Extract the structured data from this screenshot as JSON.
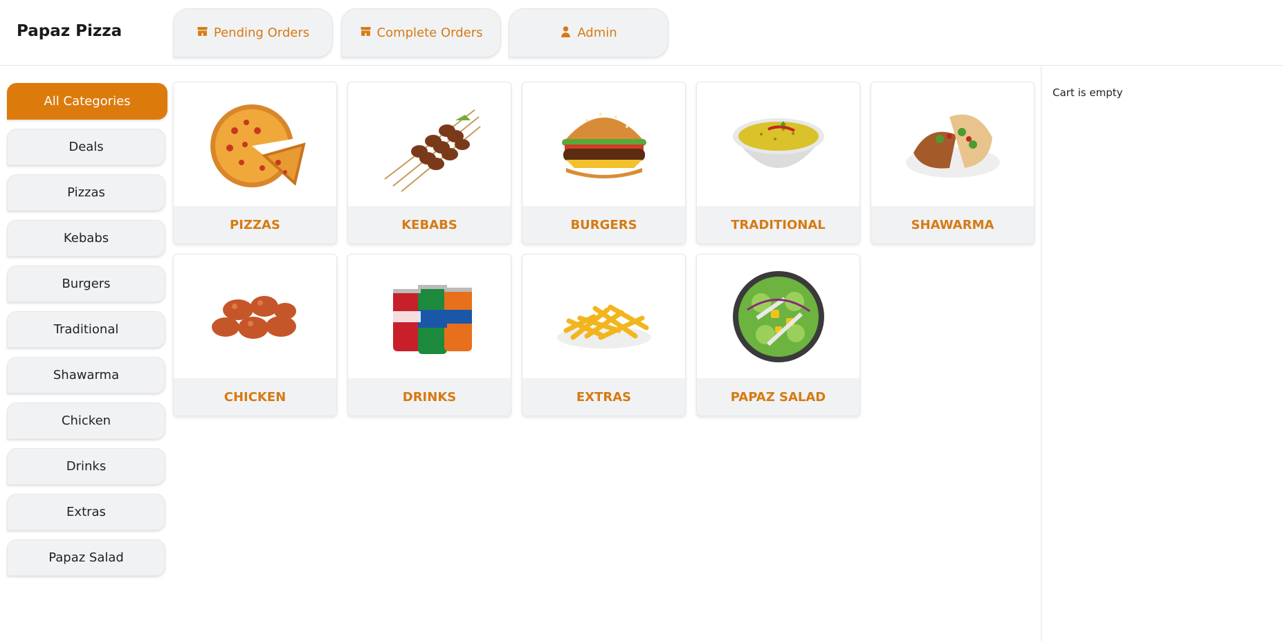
{
  "header": {
    "brand": "Papaz Pizza",
    "tabs": [
      {
        "label": "Pending Orders",
        "icon": "store-icon"
      },
      {
        "label": "Complete Orders",
        "icon": "store-icon"
      },
      {
        "label": "Admin",
        "icon": "user-icon"
      }
    ]
  },
  "sidebar": {
    "categories": [
      {
        "label": "All Categories",
        "active": true
      },
      {
        "label": "Deals"
      },
      {
        "label": "Pizzas"
      },
      {
        "label": "Kebabs"
      },
      {
        "label": "Burgers"
      },
      {
        "label": "Traditional"
      },
      {
        "label": "Shawarma"
      },
      {
        "label": "Chicken"
      },
      {
        "label": "Drinks"
      },
      {
        "label": "Extras"
      },
      {
        "label": "Papaz Salad"
      }
    ]
  },
  "grid": {
    "tiles": [
      {
        "label": "PIZZAS",
        "image": "pizza"
      },
      {
        "label": "KEBABS",
        "image": "kebab-skewers"
      },
      {
        "label": "BURGERS",
        "image": "burger"
      },
      {
        "label": "TRADITIONAL",
        "image": "daal-bowl"
      },
      {
        "label": "SHAWARMA",
        "image": "shawarma-plate"
      },
      {
        "label": "CHICKEN",
        "image": "chicken-wings"
      },
      {
        "label": "DRINKS",
        "image": "soda-cans"
      },
      {
        "label": "EXTRAS",
        "image": "fries"
      },
      {
        "label": "PAPAZ SALAD",
        "image": "salad-bowl"
      }
    ]
  },
  "cart": {
    "empty_text": "Cart is empty"
  },
  "colors": {
    "accent": "#dd7a0c",
    "accent_text": "#d67a12",
    "tile_label_bg": "#f1f2f4"
  }
}
